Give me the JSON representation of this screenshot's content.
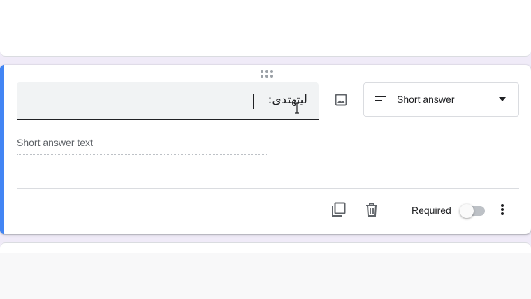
{
  "question": {
    "title_value": "لیتهتدی:",
    "answer_hint": "Short answer text",
    "type_select": {
      "selected": "Short answer",
      "icon": "short-text-icon"
    },
    "required_label": "Required",
    "required_enabled": false
  },
  "colors": {
    "accent": "#4285f4",
    "page_background": "#f0ebf8",
    "field_background": "#f1f3f4"
  },
  "icons": {
    "drag": "drag-handle-icon",
    "image": "image-icon",
    "duplicate": "copy-icon",
    "delete": "trash-icon",
    "more": "more-vert-icon",
    "dropdown": "arrow-drop-down-icon"
  }
}
